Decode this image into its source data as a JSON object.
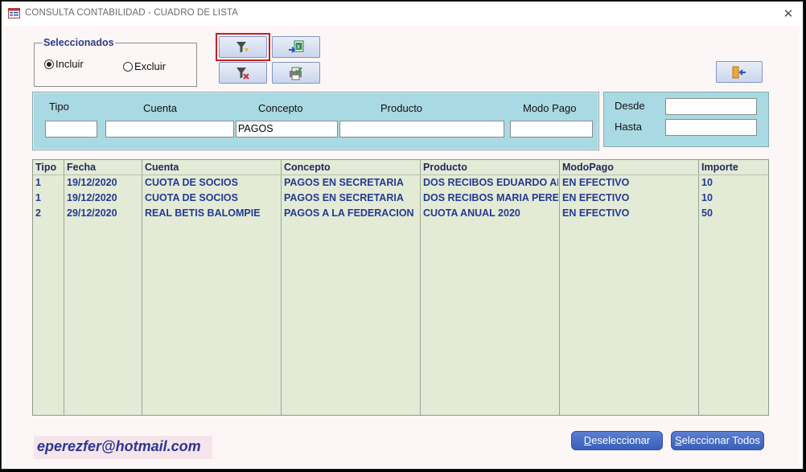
{
  "window": {
    "title": "CONSULTA CONTABILIDAD - CUADRO DE LISTA",
    "close_glyph": "✕"
  },
  "selection": {
    "legend": "Seleccionados",
    "options": [
      {
        "label": "Incluir",
        "selected": true
      },
      {
        "label": "Excluir",
        "selected": false
      }
    ]
  },
  "toolbar": {
    "buttons": [
      {
        "name": "apply-filter-button",
        "icon": "filter-icon",
        "highlighted": true
      },
      {
        "name": "export-excel-button",
        "icon": "excel-export-icon"
      },
      {
        "name": "remove-filter-button",
        "icon": "filter-clear-icon"
      },
      {
        "name": "print-button",
        "icon": "printer-icon"
      },
      {
        "name": "exit-button",
        "icon": "exit-door-icon"
      }
    ]
  },
  "filters": {
    "tipo": {
      "label": "Tipo",
      "value": ""
    },
    "cuenta": {
      "label": "Cuenta",
      "value": ""
    },
    "concepto": {
      "label": "Concepto",
      "value": "PAGOS"
    },
    "producto": {
      "label": "Producto",
      "value": ""
    },
    "modo_pago": {
      "label": "Modo Pago",
      "value": ""
    },
    "desde": {
      "label": "Desde",
      "value": ""
    },
    "hasta": {
      "label": "Hasta",
      "value": ""
    }
  },
  "list": {
    "columns": [
      "Tipo",
      "Fecha",
      "Cuenta",
      "Concepto",
      "Producto",
      "ModoPago",
      "Importe"
    ],
    "rows": [
      [
        "1",
        "19/12/2020",
        "CUOTA DE SOCIOS",
        "PAGOS EN SECRETARIA",
        "DOS RECIBOS EDUARDO ARI",
        "EN EFECTIVO",
        "10"
      ],
      [
        "1",
        "19/12/2020",
        "CUOTA DE SOCIOS",
        "PAGOS EN SECRETARIA",
        "DOS RECIBOS MARIA PEREZ",
        "EN EFECTIVO",
        "10"
      ],
      [
        "2",
        "29/12/2020",
        "REAL BETIS BALOMPIE",
        "PAGOS A LA FEDERACION",
        "CUOTA ANUAL 2020",
        "EN EFECTIVO",
        "50"
      ]
    ]
  },
  "footer": {
    "email": "eperezfer@hotmail.com",
    "deselect_label": "Deseleccionar",
    "select_all_label": "Seleccionar Todos"
  },
  "colors": {
    "filter_bar": "#a9d9e2",
    "list_bg": "#e3ebd6",
    "text_blue": "#233a92",
    "highlight": "#c42020"
  }
}
